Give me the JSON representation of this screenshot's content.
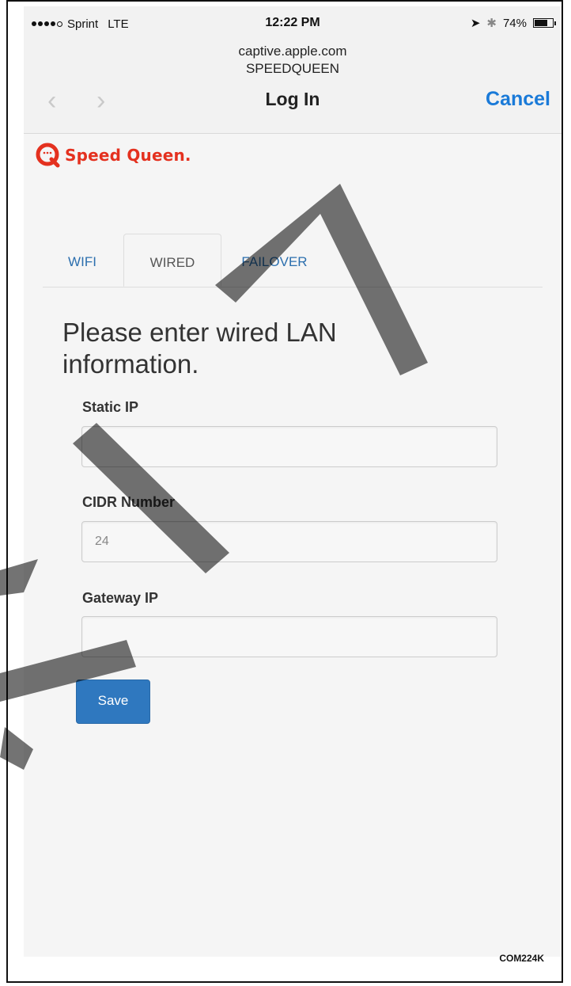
{
  "status_bar": {
    "carrier": "Sprint",
    "network": "LTE",
    "time": "12:22 PM",
    "battery": "74%",
    "battery_level": 0.74
  },
  "browser": {
    "url": "captive.apple.com",
    "site_name": "SPEEDQUEEN",
    "title": "Log In",
    "cancel_label": "Cancel"
  },
  "brand": {
    "name": "Speed Queen.",
    "color": "#e4311f"
  },
  "tabs": [
    {
      "label": "WIFI",
      "active": false
    },
    {
      "label": "WIRED",
      "active": true
    },
    {
      "label": "FAILOVER",
      "active": false
    }
  ],
  "form": {
    "heading": "Please enter wired LAN information.",
    "static_ip": {
      "label": "Static IP",
      "value": ""
    },
    "cidr": {
      "label": "CIDR Number",
      "value": "24"
    },
    "gateway_ip": {
      "label": "Gateway IP",
      "value": ""
    },
    "save_label": "Save"
  },
  "figure_id": "COM224K",
  "colors": {
    "link": "#1a7ad8",
    "tab_link": "#2c6fae",
    "primary_button": "#2f78bf"
  }
}
